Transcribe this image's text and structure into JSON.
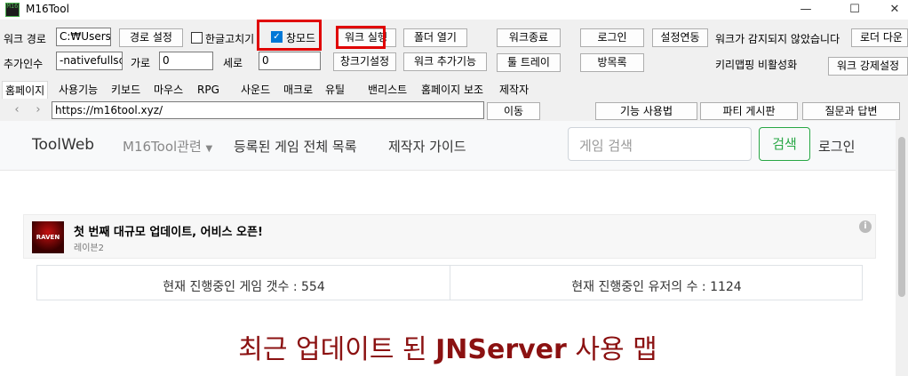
{
  "window": {
    "title": "M16Tool",
    "app_icon_text": "M16"
  },
  "controls": {
    "work_path_label": "워크 경로",
    "work_path_value": "C:₩Users",
    "path_setting": "경로 설정",
    "hangul_fix": "한글고치기",
    "window_mode": "창모드",
    "work_run": "워크 실행",
    "open_folder": "폴더 열기",
    "work_end": "워크종료",
    "login": "로그인",
    "settings_link": "설정연동",
    "not_detected": "워크가 감지되지 않았습니다",
    "loader_down": "로더 다운",
    "extra_args_label": "추가인수",
    "extra_args_value": "-nativefullsc",
    "width_label": "가로",
    "width_value": "0",
    "height_label": "세로",
    "height_value": "0",
    "window_setting": "창크기설정",
    "add_work": "워크 추가기능",
    "tool_tray": "툴 트레이",
    "guestbook": "방목록",
    "key_map": "키리맵핑 비활성화",
    "force_work_setting": "워크 강제설정"
  },
  "tabs": [
    "홈페이지",
    "사용기능",
    "키보드",
    "마우스",
    "RPG",
    "사운드",
    "매크로",
    "유틸",
    "밴리스트",
    "홈페이지 보조",
    "제작자"
  ],
  "navbar": {
    "url": "https://m16tool.xyz/",
    "go": "이동",
    "how_to": "기능 사용법",
    "party_board": "파티 게시판",
    "qna": "질문과 답변"
  },
  "site": {
    "brand": "ToolWeb",
    "menu_dropdown": "M16Tool관련",
    "nav_games": "등록된 게임 전체 목록",
    "nav_guide": "제작자 가이드",
    "search_placeholder": "게임 검색",
    "search_btn": "검색",
    "login": "로그인"
  },
  "notice": {
    "thumb_text": "RAVEN",
    "title": "첫 번째 대규모 업데이트, 어비스 오픈!",
    "subtitle": "레이븐2"
  },
  "stats": {
    "games": "현재 진행중인 게임 갯수 : 554",
    "users": "현재 진행중인 유저의 수 : 1124"
  },
  "headline": {
    "prefix": "최근 업데이트 된 ",
    "strong": "JNServer",
    "suffix": " 사용 맵"
  },
  "colors": {
    "highlight": "#e00000",
    "headline": "#8b1111",
    "search": "#28a745",
    "checkbox": "#0078d7"
  }
}
